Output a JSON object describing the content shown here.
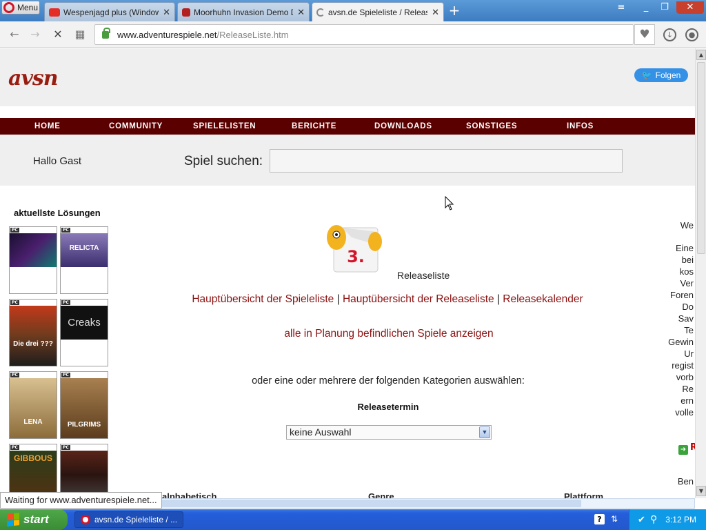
{
  "browser": {
    "menu_label": "Menu",
    "tabs": [
      {
        "title": "Wespenjagd plus (Windows ..."
      },
      {
        "title": "Moorhuhn Invasion Demo Do..."
      },
      {
        "title": "avsn.de Spieleliste / Release..."
      }
    ],
    "new_tab": "+",
    "url_host": "www.adventurespiele.net",
    "url_path": "/ReleaseListe.htm",
    "status_text": "Waiting for www.adventurespiele.net..."
  },
  "site": {
    "logo": "avsn",
    "follow_label": "Folgen",
    "nav": [
      "HOME",
      "COMMUNITY",
      "SPIELELISTEN",
      "BERICHTE",
      "DOWNLOADS",
      "SONSTIGES",
      "INFOS"
    ],
    "greeting": "Hallo Gast",
    "search_label": "Spiel suchen:"
  },
  "sidebar": {
    "title": "aktuellste Lösungen",
    "thumb_labels": [
      "",
      "RELICTA",
      "Die drei ???",
      "Creaks",
      "LENA",
      "PILGRIMS",
      "GIBBOUS",
      ""
    ]
  },
  "main": {
    "caption": "Releaseliste",
    "calendar_digit": "3.",
    "link_overview": "Hauptübersicht der Spieleliste",
    "link_release": "Hauptübersicht der Releaseliste",
    "link_calendar": "Releasekalender",
    "separator": "|",
    "planned_link": "alle in Planung befindlichen Spiele anzeigen",
    "category_text": "oder eine oder mehrere der folgenden Kategorien auswählen:",
    "release_label": "Releasetermin",
    "select_value": "keine Auswahl",
    "bottom_labels": [
      "alphabetisch",
      "Genre",
      "Plattform"
    ]
  },
  "right_column": {
    "lines": [
      "We",
      "Eine",
      "bei",
      "kos",
      "Ver",
      "Foren",
      "Do",
      "Sav",
      "Te",
      "Gewin",
      "Ur",
      "regist",
      "vorb",
      "Re",
      "ern",
      "volle",
      "R",
      "Ben"
    ]
  },
  "taskbar": {
    "start_label": "start",
    "task_title": "avsn.de Spieleliste / ...",
    "clock": "3:12 PM"
  },
  "colors": {
    "nav_bg": "#5a0000",
    "link": "#8b1111",
    "follow_button": "#3591e6"
  }
}
